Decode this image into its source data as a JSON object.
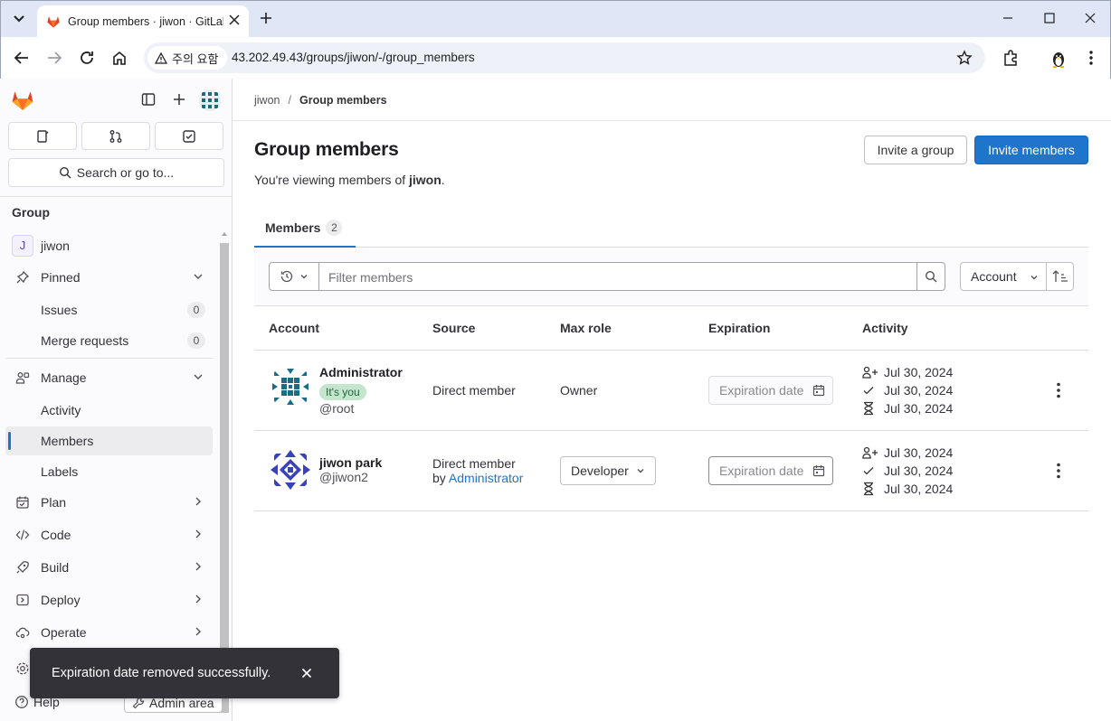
{
  "browser": {
    "tab_title": "Group members · jiwon · GitLab",
    "security_label": "주의 요함",
    "url": "43.202.49.43/groups/jiwon/-/group_members"
  },
  "sidebar": {
    "search_placeholder": "Search or go to...",
    "heading": "Group",
    "group_initial": "J",
    "group_name": "jiwon",
    "pinned": {
      "label": "Pinned",
      "items": [
        {
          "label": "Issues",
          "count": "0"
        },
        {
          "label": "Merge requests",
          "count": "0"
        }
      ]
    },
    "manage": {
      "label": "Manage",
      "items": [
        {
          "label": "Activity"
        },
        {
          "label": "Members"
        },
        {
          "label": "Labels"
        }
      ]
    },
    "sections": [
      {
        "label": "Plan"
      },
      {
        "label": "Code"
      },
      {
        "label": "Build"
      },
      {
        "label": "Deploy"
      },
      {
        "label": "Operate"
      }
    ],
    "help_label": "Help",
    "admin_label": "Admin area"
  },
  "breadcrumb": {
    "root": "jiwon",
    "current": "Group members"
  },
  "page": {
    "title": "Group members",
    "subtitle_prefix": "You're viewing members of ",
    "subtitle_group": "jiwon",
    "subtitle_suffix": ".",
    "invite_group_label": "Invite a group",
    "invite_members_label": "Invite members"
  },
  "tabs": [
    {
      "label": "Members",
      "count": "2"
    }
  ],
  "filter": {
    "placeholder": "Filter members",
    "sort_label": "Account"
  },
  "table": {
    "headers": {
      "account": "Account",
      "source": "Source",
      "max_role": "Max role",
      "expiration": "Expiration",
      "activity": "Activity"
    },
    "rows": [
      {
        "name": "Administrator",
        "badge": "It's you",
        "username": "@root",
        "source": "Direct member",
        "source_by": "",
        "source_by_link": "",
        "role": "Owner",
        "expiration_placeholder": "Expiration date",
        "activity": {
          "created": "Jul 30, 2024",
          "access_granted": "Jul 30, 2024",
          "last_activity": "Jul 30, 2024"
        }
      },
      {
        "name": "jiwon park",
        "badge": "",
        "username": "@jiwon2",
        "source": "Direct member",
        "source_by": "by ",
        "source_by_link": "Administrator",
        "role": "Developer",
        "expiration_placeholder": "Expiration date",
        "activity": {
          "created": "Jul 30, 2024",
          "access_granted": "Jul 30, 2024",
          "last_activity": "Jul 30, 2024"
        }
      }
    ]
  },
  "toast": {
    "message": "Expiration date removed successfully."
  },
  "colors": {
    "primary": "#1f75cb",
    "badge_green": "#c3e6cd",
    "toast_bg": "#333238"
  }
}
